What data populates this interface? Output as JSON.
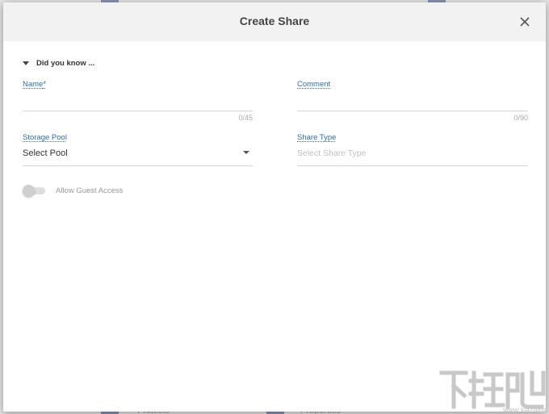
{
  "dialog": {
    "title": "Create Share",
    "close_icon": "close-icon",
    "did_you_know_label": "Did you know ..."
  },
  "form": {
    "name": {
      "label": "Name",
      "required_marker": "*",
      "value": "",
      "counter": "0/45"
    },
    "comment": {
      "label": "Comment",
      "value": "",
      "counter": "0/90"
    },
    "storage_pool": {
      "label": "Storage Pool",
      "selected": "Select Pool"
    },
    "share_type": {
      "label": "Share Type",
      "placeholder": "Select Share Type"
    },
    "guest_access": {
      "label": "Allow Guest Access",
      "enabled": false
    }
  },
  "background": {
    "item_labels": [
      "Projects",
      "Properties"
    ]
  },
  "colors": {
    "accent": "#2e6db4",
    "header_bg": "#f2f2f2",
    "backdrop": "#e3e3e3"
  }
}
